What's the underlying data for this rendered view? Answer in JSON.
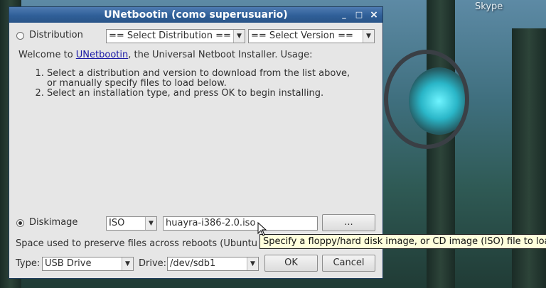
{
  "desktop": {
    "label": "Skype"
  },
  "window": {
    "title": "UNetbootin (como superusuario)",
    "buttons": {
      "close": "×",
      "minimize": "_",
      "maximize": "□"
    },
    "distribution": {
      "label": "Distribution",
      "select_distribution": "== Select Distribution ==",
      "select_version": "== Select Version =="
    },
    "intro": {
      "welcome_prefix": "Welcome to ",
      "link": "UNetbootin",
      "welcome_suffix": ", the Universal Netboot Installer. Usage:"
    },
    "steps": [
      "Select a distribution and version to download from the list above, or manually specify files to load below.",
      "Select an installation type, and press OK to begin installing."
    ],
    "diskimage": {
      "label": "Diskimage",
      "type": "ISO",
      "path": "huayra-i386-2.0.iso",
      "browse": "..."
    },
    "space_note": "Space used to preserve files across reboots (Ubuntu only):",
    "type": {
      "label": "Type:",
      "value": "USB Drive"
    },
    "drive": {
      "label": "Drive:",
      "value": "/dev/sdb1"
    },
    "ok": "OK",
    "cancel": "Cancel"
  },
  "tooltip": "Specify a floppy/hard disk image, or CD image (ISO) file to load"
}
